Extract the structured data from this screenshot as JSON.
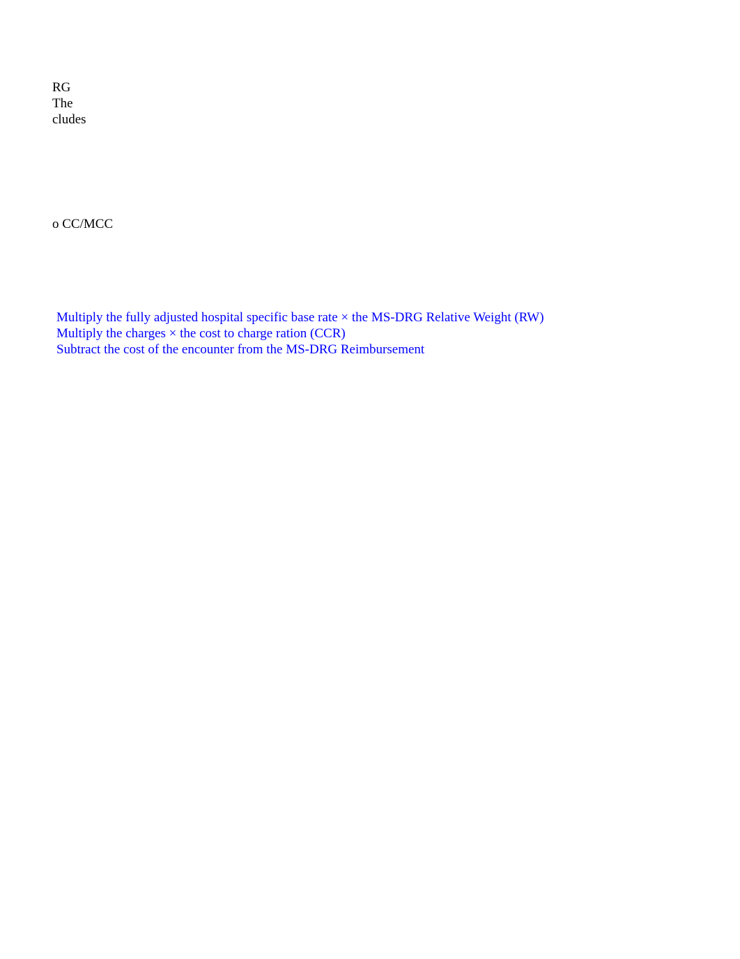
{
  "fragment1": {
    "line1": "RG",
    "line2": " The",
    "line3": "cludes"
  },
  "fragment2": {
    "line1": "o CC/MCC"
  },
  "instructions": {
    "line1": "Multiply the fully adjusted hospital specific base rate × the MS-DRG Relative Weight (RW)",
    "line2": "Multiply the charges × the cost to charge ration (CCR)",
    "line3": "Subtract the cost of the encounter from the MS-DRG Reimbursement"
  }
}
